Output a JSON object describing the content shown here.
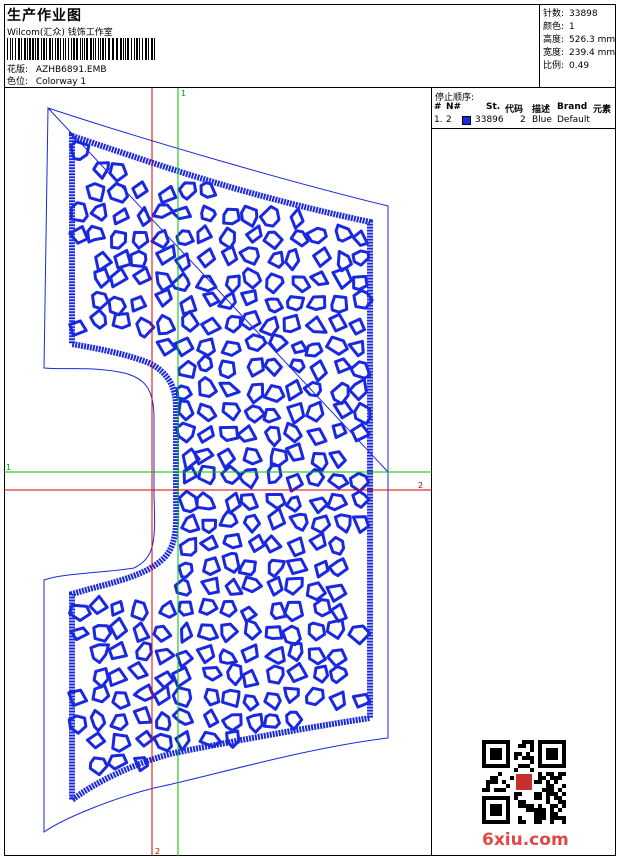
{
  "header": {
    "title": "生产作业图",
    "subtitle": "Wilcom(汇众) 钱饰工作室",
    "design_label": "花版:",
    "design_value": "AZHB6891.EMB",
    "colorway_label": "色位:",
    "colorway_value": "Colorway 1"
  },
  "stats": [
    {
      "label": "针数:",
      "value": "33898"
    },
    {
      "label": "颜色:",
      "value": "1"
    },
    {
      "label": "高度:",
      "value": "526.3 mm"
    },
    {
      "label": "宽度:",
      "value": "239.4 mm"
    },
    {
      "label": "比例:",
      "value": "0.49"
    }
  ],
  "stop_sequence": {
    "title": "停止顺序:",
    "columns": [
      "#",
      "N#",
      "St.",
      "代码",
      "描述",
      "Brand",
      "元素"
    ],
    "rows": [
      {
        "index": "1.",
        "needle": "2",
        "stitches": "33896",
        "code": "2",
        "description": "Blue",
        "brand": "Default",
        "color": "#1a29e0"
      }
    ]
  },
  "design": {
    "stitch_color": "#1a29e0",
    "outline_color": "#1a29e0",
    "guide_red": "#e00000",
    "guide_green": "#00c000",
    "green_vertical_label": "1",
    "green_horizontal_label": "1",
    "red_horizontal_label": "2",
    "red_vertical_label": "2"
  },
  "watermark": {
    "text": "6xiu.com",
    "color": "#e04848"
  }
}
